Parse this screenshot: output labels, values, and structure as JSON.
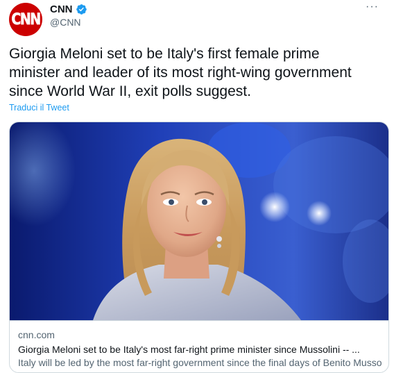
{
  "author": {
    "display_name": "CNN",
    "handle": "@CNN",
    "avatar_text": "CNN",
    "verified": true,
    "brand_color": "#cc0000",
    "verified_color": "#1d9bf0"
  },
  "more_menu": {
    "icon": "more-horizontal-icon",
    "label": "···"
  },
  "tweet": {
    "text": "Giorgia Meloni set to be Italy's first female prime\nminister and leader of its most right-wing government\nsince World War II, exit polls suggest.",
    "translate_label": "Traduci il Tweet"
  },
  "card": {
    "domain": "cnn.com",
    "title": "Giorgia Meloni set to be Italy's most far-right prime minister since Mussolini -- ...",
    "description": "Italy will be led by the most far-right government since the final days of Benito Mussolini"
  }
}
